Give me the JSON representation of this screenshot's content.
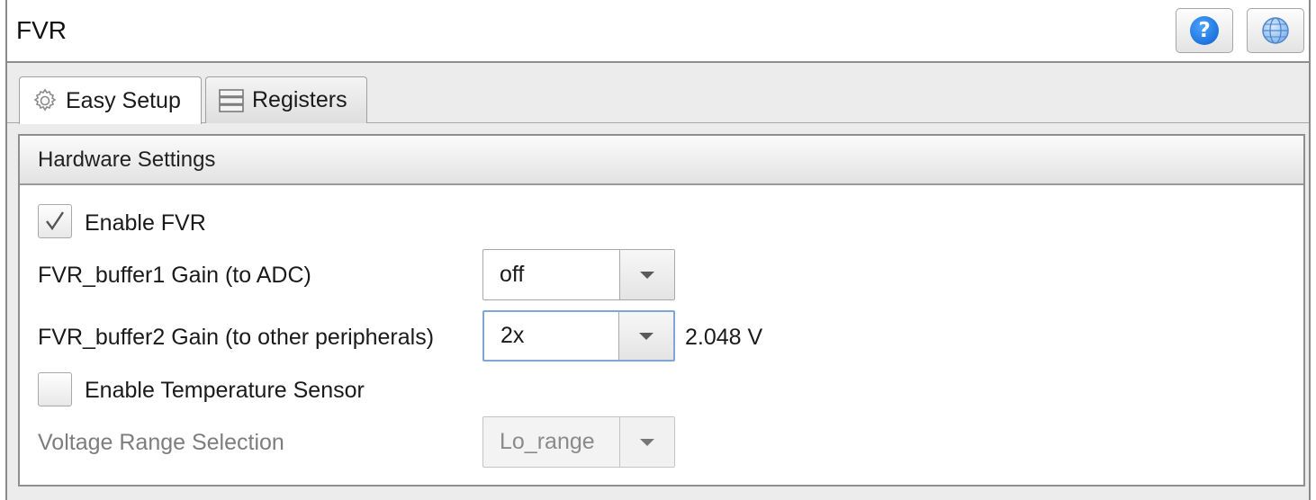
{
  "window": {
    "title": "FVR"
  },
  "toolbar": {
    "help_icon": "question-circle-icon",
    "globe_icon": "globe-icon",
    "help_glyph": "?"
  },
  "tabs": [
    {
      "label": "Easy Setup",
      "icon": "gear-icon",
      "active": true
    },
    {
      "label": "Registers",
      "icon": "registers-icon",
      "active": false
    }
  ],
  "panel": {
    "title": "Hardware Settings",
    "enable_fvr": {
      "label": "Enable FVR",
      "checked": true
    },
    "buffer1": {
      "label": "FVR_buffer1 Gain (to ADC)",
      "value": "off"
    },
    "buffer2": {
      "label": "FVR_buffer2 Gain (to other peripherals)",
      "value": "2x",
      "readout": "2.048 V"
    },
    "temp_sensor": {
      "label": "Enable Temperature Sensor",
      "checked": false
    },
    "voltage_range": {
      "label": "Voltage Range Selection",
      "value": "Lo_range",
      "disabled": true
    }
  },
  "colors": {
    "help_blue": "#1a74e8",
    "focus_border": "#7ea6d6"
  }
}
